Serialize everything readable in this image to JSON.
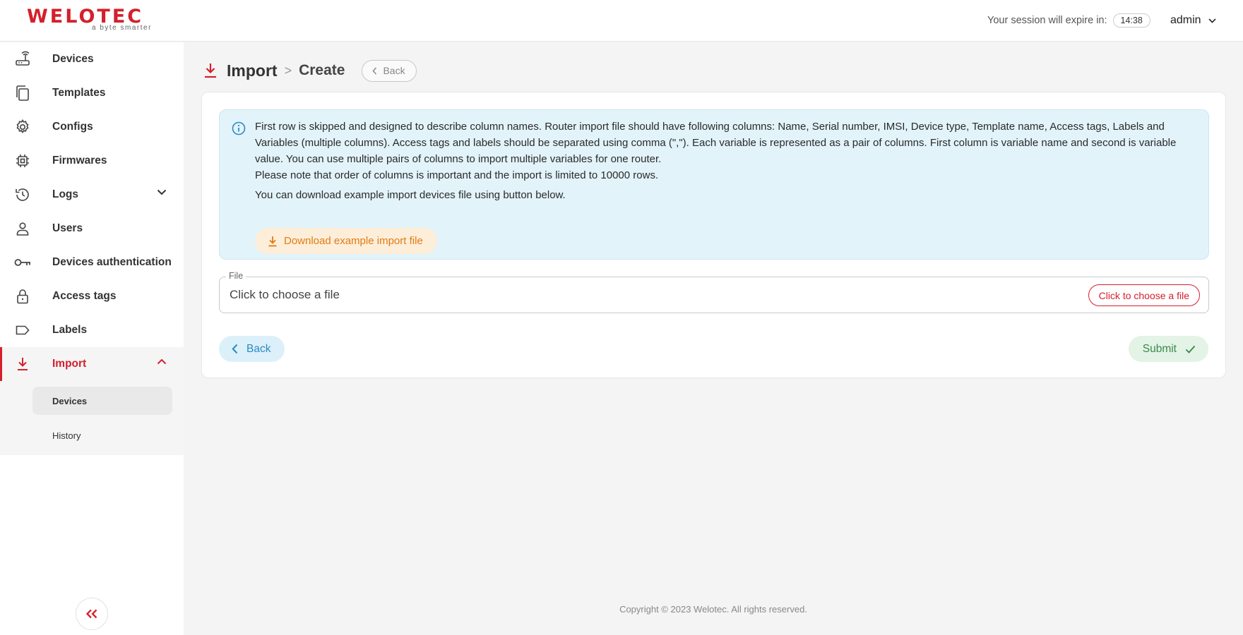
{
  "header": {
    "logo_text": "WELOTEC",
    "logo_tagline": "a byte smarter",
    "session_label": "Your session will expire in:",
    "session_timer": "14:38",
    "user_name": "admin"
  },
  "sidebar": {
    "items": [
      {
        "label": "Devices",
        "icon": "router-icon"
      },
      {
        "label": "Templates",
        "icon": "copy-icon"
      },
      {
        "label": "Configs",
        "icon": "gear-icon"
      },
      {
        "label": "Firmwares",
        "icon": "chip-icon"
      },
      {
        "label": "Logs",
        "icon": "history-icon"
      },
      {
        "label": "Users",
        "icon": "user-icon"
      },
      {
        "label": "Devices authentication",
        "icon": "key-icon"
      },
      {
        "label": "Access tags",
        "icon": "lock-icon"
      },
      {
        "label": "Labels",
        "icon": "label-icon"
      },
      {
        "label": "Import",
        "icon": "download-icon"
      }
    ],
    "import_submenu": [
      {
        "label": "Devices"
      },
      {
        "label": "History"
      }
    ],
    "active_item": "Import",
    "active_subitem": "Devices"
  },
  "page": {
    "title": "Import",
    "separator": ">",
    "subtitle": "Create",
    "back_label": "Back"
  },
  "info": {
    "paragraph1": "First row is skipped and designed to describe column names. Router import file should have following columns: Name, Serial number, IMSI, Device type, Template name, Access tags, Labels and Variables (multiple columns). Access tags and labels should be separated using comma (\",\"). Each variable is represented as a pair of columns. First column is variable name and second is variable value. You can use multiple pairs of columns to import multiple variables for one router.",
    "paragraph2": "Please note that order of columns is important and the import is limited to 10000 rows.",
    "paragraph3": "You can download example import devices file using button below.",
    "download_label": "Download example import file"
  },
  "form": {
    "file_label": "File",
    "file_placeholder": "Click to choose a file",
    "file_button": "Click to choose a file",
    "back_label": "Back",
    "submit_label": "Submit"
  },
  "footer": {
    "copyright": "Copyright © 2023 Welotec. All rights reserved."
  },
  "colors": {
    "brand_red": "#d4202c",
    "info_bg": "#e2f3fa",
    "download_orange": "#e07c14",
    "back_blue": "#2a8bc4",
    "submit_green": "#3b8a4a"
  }
}
